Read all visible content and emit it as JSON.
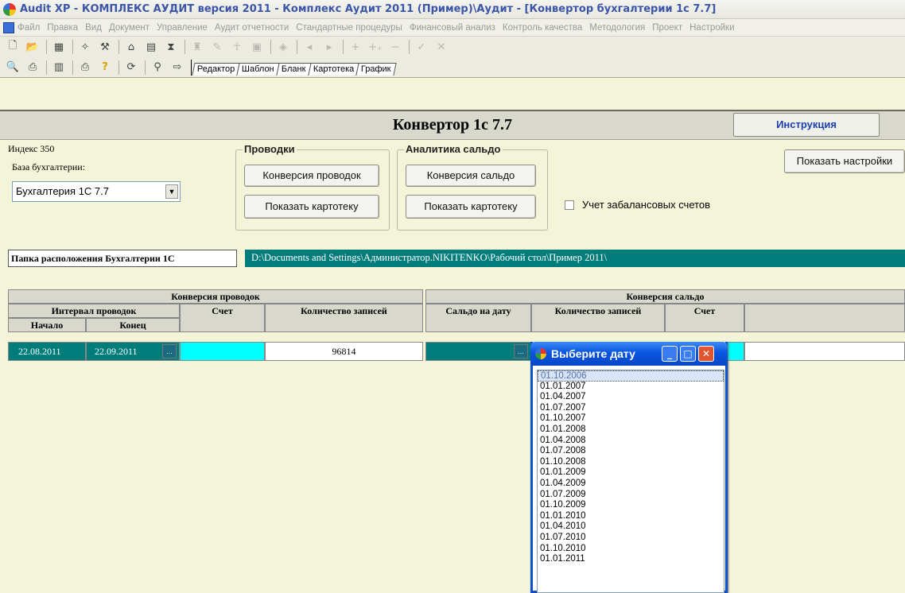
{
  "window": {
    "title": "Audit XP - КОМПЛЕКС АУДИТ версия 2011 - Комплекс Аудит 2011 (Пример)\\Аудит - [Конвертор бухгалтерии 1с 7.7]"
  },
  "menu": [
    "Файл",
    "Правка",
    "Вид",
    "Документ",
    "Управление",
    "Аудит отчетности",
    "Стандартные процедуры",
    "Финансовый анализ",
    "Контроль качества",
    "Методология",
    "Проект",
    "Настройки"
  ],
  "tabs": [
    "Редактор",
    "Шаблон",
    "Бланк",
    "Картотека",
    "График"
  ],
  "header": {
    "title": "Конвертор 1с 7.7",
    "instruction_button": "Инструкция"
  },
  "settings": {
    "index_label": "Индекс 350",
    "base_label": "База бухгалтерии:",
    "base_value": "Бухгалтерия 1С 7.7",
    "show_settings_button": "Показать настройки",
    "offbalance_label": "Учет забалансовых счетов",
    "offbalance_checked": false
  },
  "entries_group": {
    "title": "Проводки",
    "convert_button": "Конверсия проводок",
    "show_card_button": "Показать картотеку"
  },
  "balance_group": {
    "title": "Аналитика сальдо",
    "convert_button": "Конверсия сальдо",
    "show_card_button": "Показать картотеку"
  },
  "path": {
    "label": "Папка расположения Бухгалтерии 1С",
    "value": "D:\\Documents and Settings\\Администратор.NIKITENKO\\Рабочий стол\\Пример 2011\\"
  },
  "entries_table": {
    "title": "Конверсия проводок",
    "interval_header": "Интервал проводок",
    "start_header": "Начало",
    "end_header": "Конец",
    "account_header": "Счет",
    "count_header": "Количество записей",
    "row": {
      "start": "22.08.2011",
      "end": "22.09.2011",
      "account": "",
      "count": "96814"
    }
  },
  "balance_table": {
    "title": "Конверсия сальдо",
    "date_header": "Сальдо на дату",
    "count_header": "Количество записей",
    "account_header": "Счет"
  },
  "date_picker": {
    "title": "Выберите дату",
    "selected": "01.10.2006",
    "dates": [
      "01.10.2006",
      "01.01.2007",
      "01.04.2007",
      "01.07.2007",
      "01.10.2007",
      "01.01.2008",
      "01.04.2008",
      "01.07.2008",
      "01.10.2008",
      "01.01.2009",
      "01.04.2009",
      "01.07.2009",
      "01.10.2009",
      "01.01.2010",
      "01.04.2010",
      "01.07.2010",
      "01.10.2010",
      "01.01.2011"
    ]
  },
  "colors": {
    "teal": "#007d7b",
    "cyan": "#00ffff",
    "background": "#f4f4d8",
    "link_blue": "#1b3fb0"
  }
}
